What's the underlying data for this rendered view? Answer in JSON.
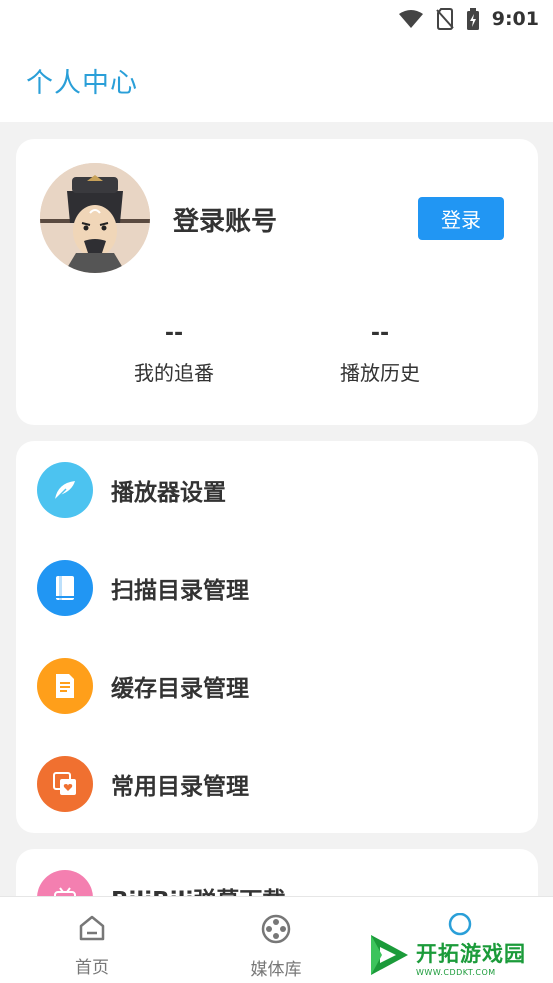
{
  "status_bar": {
    "time": "9:01",
    "icons": [
      "wifi-icon",
      "no-sim-icon",
      "battery-charging-icon"
    ]
  },
  "header": {
    "title": "个人中心",
    "color": "#2a9fd8"
  },
  "profile": {
    "account_label": "登录账号",
    "login_button": "登录",
    "stats": [
      {
        "value": "--",
        "label": "我的追番"
      },
      {
        "value": "--",
        "label": "播放历史"
      }
    ]
  },
  "menu": [
    {
      "label": "播放器设置",
      "icon": "feather-icon",
      "color": "#4cc3f0"
    },
    {
      "label": "扫描目录管理",
      "icon": "book-icon",
      "color": "#2196f3"
    },
    {
      "label": "缓存目录管理",
      "icon": "document-icon",
      "color": "#ff9f1a"
    },
    {
      "label": "常用目录管理",
      "icon": "heart-folder-icon",
      "color": "#f07030"
    }
  ],
  "extra_menu": [
    {
      "label": "BiliBili弹幕下载",
      "icon": "bilibili-icon",
      "color": "#f47fb0"
    }
  ],
  "bottom_nav": [
    {
      "label": "首页",
      "icon": "home-icon"
    },
    {
      "label": "媒体库",
      "icon": "film-reel-icon"
    },
    {
      "label": "",
      "icon": "circle-icon"
    }
  ],
  "watermark": {
    "main": "开拓游戏园",
    "sub": "WWW.CDDKT.COM"
  }
}
